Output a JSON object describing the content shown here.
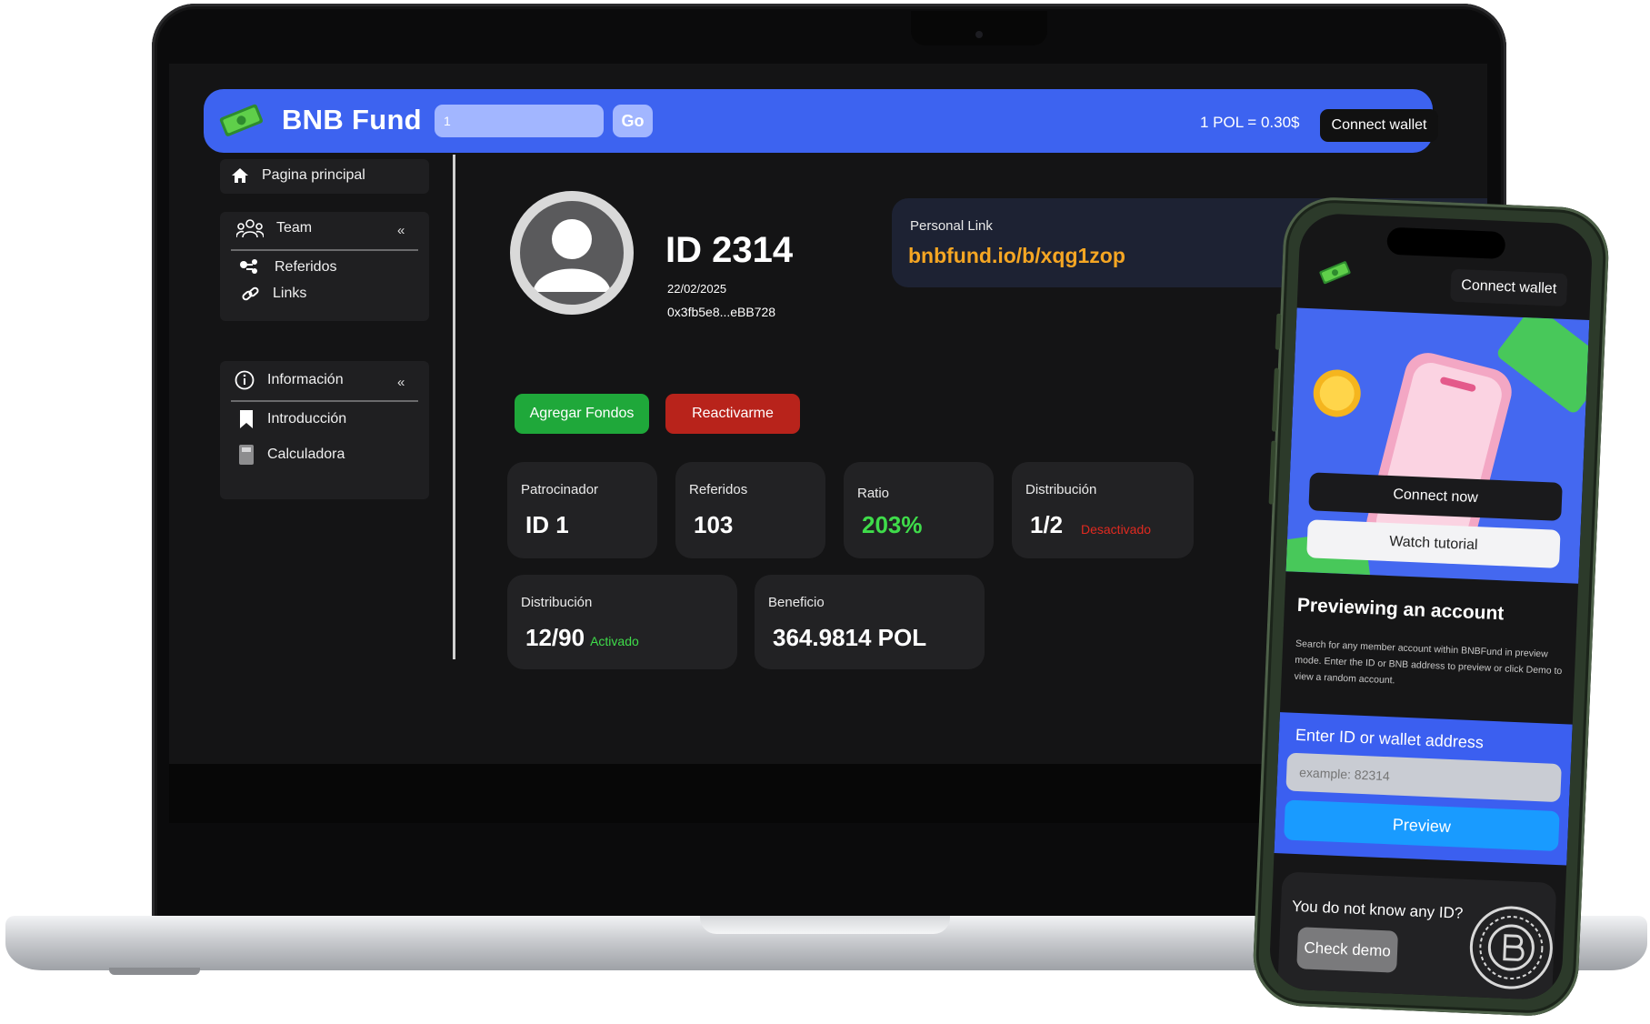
{
  "header": {
    "brand": "BNB Fund",
    "search_value": "1",
    "go_label": "Go",
    "rate": "1 POL = 0.30$",
    "connect_label": "Connect wallet"
  },
  "sidebar": {
    "home": "Pagina principal",
    "team_section": {
      "title": "Team",
      "collapse": "«",
      "items": [
        "Referidos",
        "Links"
      ]
    },
    "info_section": {
      "title": "Información",
      "collapse": "«",
      "items": [
        "Introducción",
        "Calculadora"
      ]
    }
  },
  "profile": {
    "id": "ID 2314",
    "date": "22/02/2025",
    "wallet": "0x3fb5e8...eBB728"
  },
  "personal_link": {
    "label": "Personal Link",
    "url": "bnbfund.io/b/xqg1zop"
  },
  "actions": {
    "add_funds": "Agregar Fondos",
    "reactivate": "Reactivarme"
  },
  "stats": {
    "sponsor": {
      "label": "Patrocinador",
      "value": "ID 1"
    },
    "referrals": {
      "label": "Referidos",
      "value": "103"
    },
    "ratio": {
      "label": "Ratio",
      "value": "203%"
    },
    "distribution_a": {
      "label": "Distribución",
      "value": "1/2",
      "status": "Desactivado"
    },
    "distribution_b": {
      "label": "Distribución",
      "value": "12/90",
      "status": "Activado"
    },
    "benefit": {
      "label": "Beneficio",
      "value": "364.9814 POL"
    }
  },
  "phone": {
    "connect_label": "Connect wallet",
    "connect_now": "Connect now",
    "watch_tutorial": "Watch tutorial",
    "preview_title": "Previewing an account",
    "preview_desc": "Search for any member account within BNBFund in preview mode. Enter the ID or BNB address to preview or click Demo to view a random account.",
    "form_label": "Enter ID or wallet address",
    "input_placeholder": "example: 82314",
    "preview_button": "Preview",
    "unknown_question": "You do not know any ID?",
    "demo_button": "Check demo"
  },
  "colors": {
    "accent_blue": "#3d63f0",
    "link_orange": "#f5a623",
    "positive_green": "#3fdc4a",
    "negative_red": "#e02a20",
    "button_green": "#1fa83a",
    "button_red": "#b8231b"
  },
  "icons": [
    "money-bill-logo",
    "home-icon",
    "team-icon",
    "referrals-icon",
    "link-icon",
    "info-icon",
    "bookmark-icon",
    "calculator-icon",
    "avatar-icon",
    "coin-icon",
    "bnb-coin-icon"
  ]
}
